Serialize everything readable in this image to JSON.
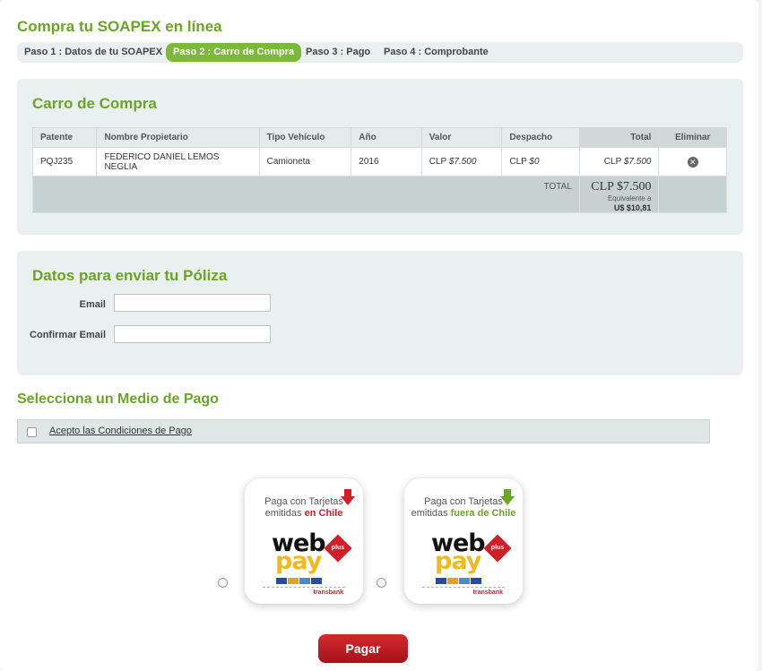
{
  "page_title": "Compra tu SOAPEX en línea",
  "steps": [
    {
      "label": "Paso 1 : Datos de tu SOAPEX",
      "active": false
    },
    {
      "label": "Paso 2 : Carro de Compra",
      "active": true
    },
    {
      "label": "Paso 3 : Pago",
      "active": false
    },
    {
      "label": "Paso 4 : Comprobante",
      "active": false
    }
  ],
  "cart": {
    "title": "Carro de Compra",
    "headers": [
      "Patente",
      "Nombre Propietario",
      "Tipo Vehículo",
      "Año",
      "Valor",
      "Despacho",
      "Total",
      "Eliminar"
    ],
    "row": {
      "patente": "PQJ235",
      "propietario": "FEDERICO DANIEL LEMOS NEGLIA",
      "tipo": "Camioneta",
      "anio": "2016",
      "valor_prefix": "CLP",
      "valor": "$7.500",
      "despacho_prefix": "CLP",
      "despacho": "$0",
      "total_prefix": "CLP",
      "total": "$7.500",
      "remove_icon": "✕"
    },
    "summary": {
      "label": "TOTAL",
      "amount": "CLP $7.500",
      "equiv_label": "Equivalente a",
      "usd": "U$ $10,81"
    }
  },
  "poliza": {
    "title": "Datos para enviar tu Póliza",
    "email_label": "Email",
    "email_value": "",
    "confirm_label": "Confirmar Email",
    "confirm_value": ""
  },
  "payment": {
    "title": "Selecciona un Medio de Pago",
    "accept_label": "Acepto las Condiciones de Pago",
    "option1": {
      "line1": "Paga con Tarjetas",
      "line2a": "emitidas ",
      "line2b": "en Chile"
    },
    "option2": {
      "line1": "Paga con Tarjetas",
      "line2a": "emitidas ",
      "line2b": "fuera de Chile"
    },
    "logo_web": "web",
    "logo_pay": "pay",
    "logo_plus": "plus",
    "transbank": "transbank",
    "pay_button": "Pagar"
  },
  "colors": {
    "accent_green": "#6aa524",
    "brand_red": "#d01f26",
    "panel_bg": "#eaf0f0"
  }
}
